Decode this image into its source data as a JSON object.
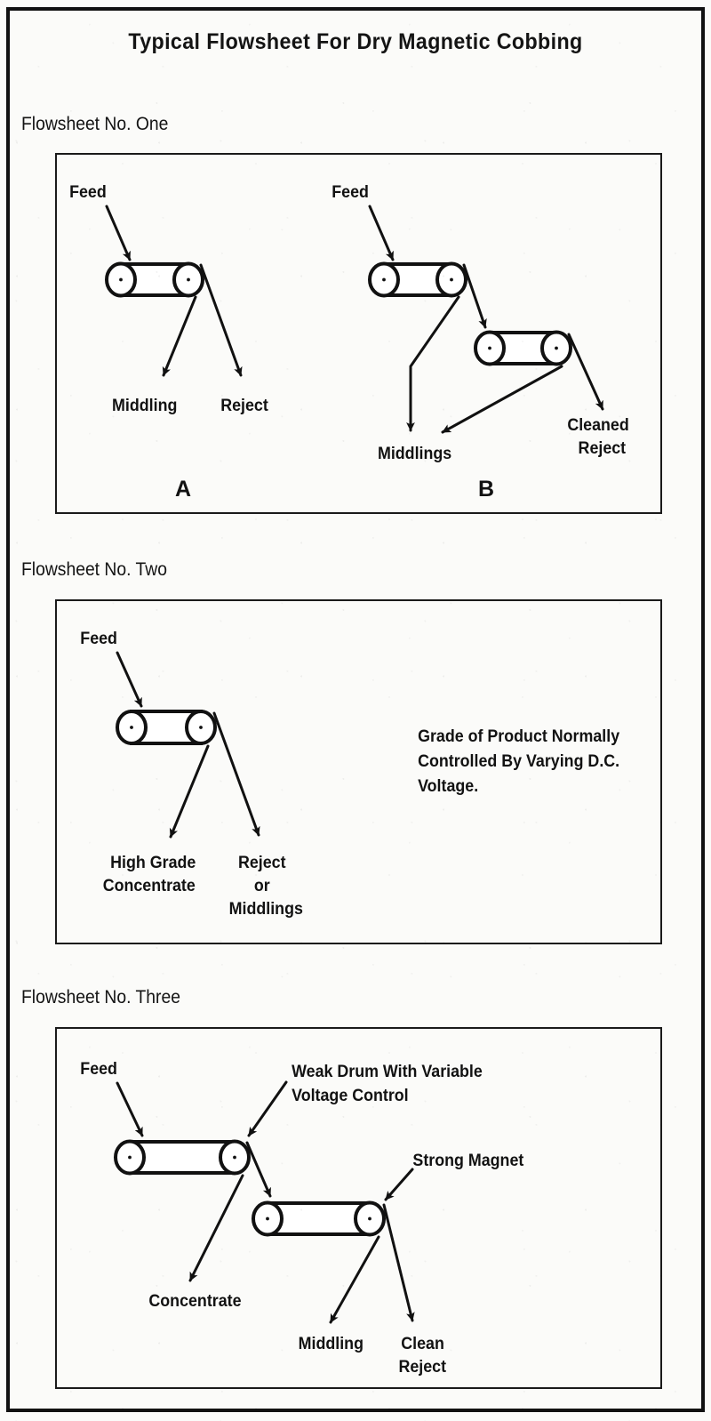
{
  "figure": {
    "title": "Typical Flowsheet For Dry Magnetic Cobbing"
  },
  "sections": [
    {
      "heading": "Flowsheet No. One",
      "panels": [
        {
          "letter": "A",
          "labels": {
            "feed": "Feed",
            "middling": "Middling",
            "reject": "Reject"
          }
        },
        {
          "letter": "B",
          "labels": {
            "feed": "Feed",
            "middlings": "Middlings",
            "cleaned_reject_line1": "Cleaned",
            "cleaned_reject_line2": "Reject"
          }
        }
      ]
    },
    {
      "heading": "Flowsheet No. Two",
      "labels": {
        "feed": "Feed",
        "concentrate_line1": "High Grade",
        "concentrate_line2": "Concentrate",
        "reject_line1": "Reject",
        "reject_line2": "or",
        "reject_line3": "Middlings"
      },
      "note": {
        "line1": "Grade of Product Normally",
        "line2": "Controlled By Varying D.C.",
        "line3": "Voltage."
      }
    },
    {
      "heading": "Flowsheet No. Three",
      "labels": {
        "feed": "Feed",
        "weak_drum_line1": "Weak Drum With Variable",
        "weak_drum_line2": "Voltage Control",
        "strong_magnet": "Strong Magnet",
        "concentrate": "Concentrate",
        "middling": "Middling",
        "clean_reject_line1": "Clean",
        "clean_reject_line2": "Reject"
      }
    }
  ],
  "colors": {
    "ink": "#111111",
    "paper": "#fbfbf9"
  },
  "chart_data": {
    "type": "diagram",
    "title": "Typical Flowsheet For Dry Magnetic Cobbing",
    "diagram_kind": "process-flowsheet",
    "flowsheets": [
      {
        "name": "Flowsheet No. One",
        "variants": [
          {
            "id": "A",
            "units": [
              {
                "type": "magnetic-drum",
                "count": 1
              }
            ],
            "streams": [
              "Feed",
              "Middling",
              "Reject"
            ]
          },
          {
            "id": "B",
            "units": [
              {
                "type": "magnetic-drum",
                "count": 2
              }
            ],
            "streams": [
              "Feed",
              "Middlings",
              "Cleaned Reject"
            ]
          }
        ]
      },
      {
        "name": "Flowsheet No. Two",
        "units": [
          {
            "type": "magnetic-drum",
            "count": 1
          }
        ],
        "streams": [
          "Feed",
          "High Grade Concentrate",
          "Reject or Middlings"
        ],
        "note": "Grade of Product Normally Controlled By Varying D.C. Voltage."
      },
      {
        "name": "Flowsheet No. Three",
        "units": [
          {
            "type": "magnetic-drum",
            "label": "Weak Drum With Variable Voltage Control"
          },
          {
            "type": "magnetic-drum",
            "label": "Strong Magnet"
          }
        ],
        "streams": [
          "Feed",
          "Concentrate",
          "Middling",
          "Clean Reject"
        ]
      }
    ]
  }
}
